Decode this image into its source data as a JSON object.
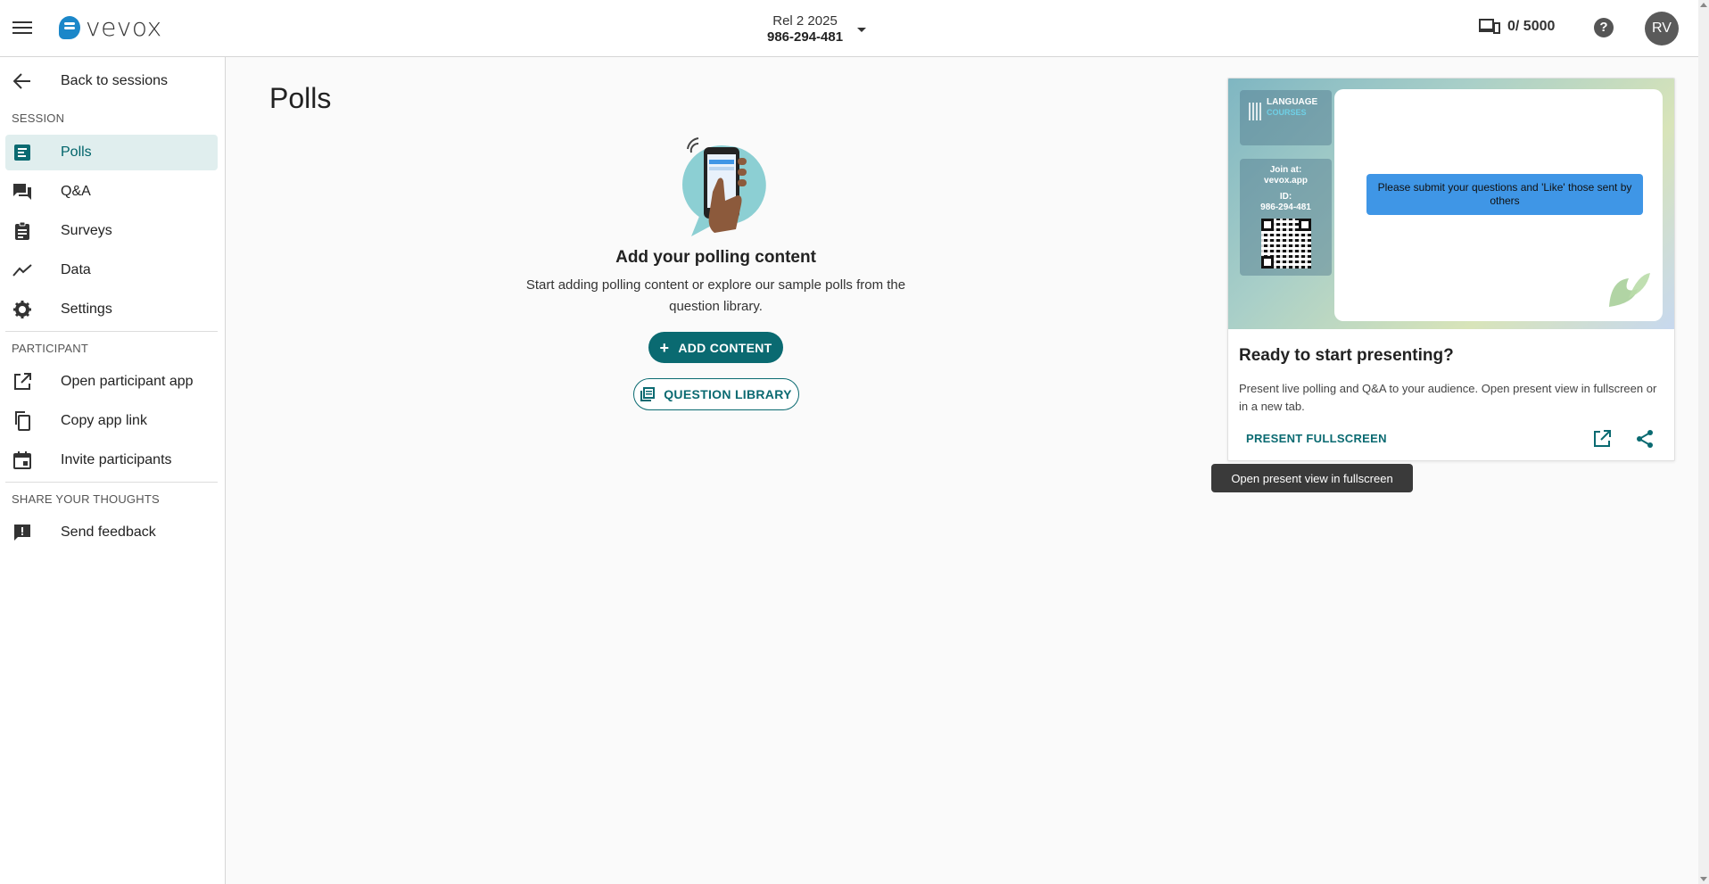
{
  "colors": {
    "accent": "#0a6a71",
    "active_bg": "#e0eeee",
    "brand_blue": "#1b87c9",
    "message_bubble": "#3f96e6"
  },
  "header": {
    "logo_text": "vevox",
    "session_name": "Rel 2 2025",
    "session_code": "986-294-481",
    "device_count": "0/ 5000",
    "help_label": "?",
    "avatar_initials": "RV"
  },
  "sidebar": {
    "back_label": "Back to sessions",
    "session_section": "SESSION",
    "session_items": [
      {
        "label": "Polls",
        "icon": "polls-icon",
        "active": true
      },
      {
        "label": "Q&A",
        "icon": "qa-icon"
      },
      {
        "label": "Surveys",
        "icon": "clipboard-icon"
      },
      {
        "label": "Data",
        "icon": "trend-icon"
      },
      {
        "label": "Settings",
        "icon": "gear-icon"
      }
    ],
    "participant_section": "PARTICIPANT",
    "participant_items": [
      {
        "label": "Open participant app",
        "icon": "open-external-icon"
      },
      {
        "label": "Copy app link",
        "icon": "copy-icon"
      },
      {
        "label": "Invite participants",
        "icon": "calendar-icon"
      }
    ],
    "feedback_section": "SHARE YOUR THOUGHTS",
    "feedback_items": [
      {
        "label": "Send feedback",
        "icon": "feedback-icon"
      }
    ]
  },
  "main": {
    "title": "Polls",
    "empty_title": "Add your polling content",
    "empty_text": "Start adding polling content or explore our sample polls from the question library.",
    "add_button": "ADD CONTENT",
    "library_button": "QUESTION LIBRARY"
  },
  "preview_card": {
    "brand_line1": "LANGUAGE",
    "brand_line2": "COURSES",
    "join_label": "Join at:",
    "join_url": "vevox.app",
    "id_label": "ID:",
    "id_value": "986-294-481",
    "message": "Please submit your questions and 'Like' those sent by others",
    "title": "Ready to start presenting?",
    "description": "Present live polling and Q&A to your audience. Open present view in fullscreen or in a new tab.",
    "present_button": "PRESENT FULLSCREEN",
    "tooltip": "Open present view in fullscreen"
  }
}
